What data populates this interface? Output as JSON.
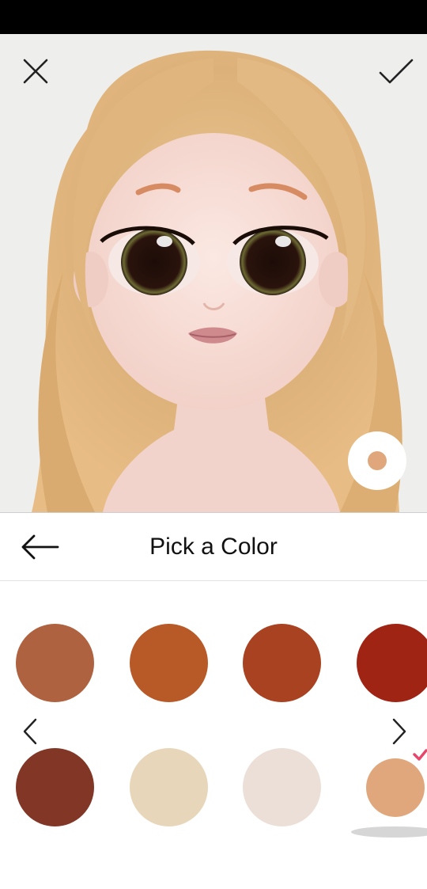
{
  "editor": {
    "close_icon": "close-icon",
    "confirm_icon": "checkmark-icon",
    "current_color": "#e0a77c"
  },
  "header": {
    "title": "Pick a Color",
    "back_icon": "arrow-left-icon"
  },
  "palette": {
    "prev_icon": "chevron-left-icon",
    "next_icon": "chevron-right-icon",
    "selected_index": 7,
    "swatches": [
      {
        "color": "#ae6240"
      },
      {
        "color": "#b75a28"
      },
      {
        "color": "#a94221"
      },
      {
        "color": "#a02414"
      },
      {
        "color": "#823625"
      },
      {
        "color": "#e7d6b9"
      },
      {
        "color": "#ebdfd7"
      },
      {
        "color": "#e0a77c"
      }
    ],
    "selected_check_color": "#e8456b"
  }
}
